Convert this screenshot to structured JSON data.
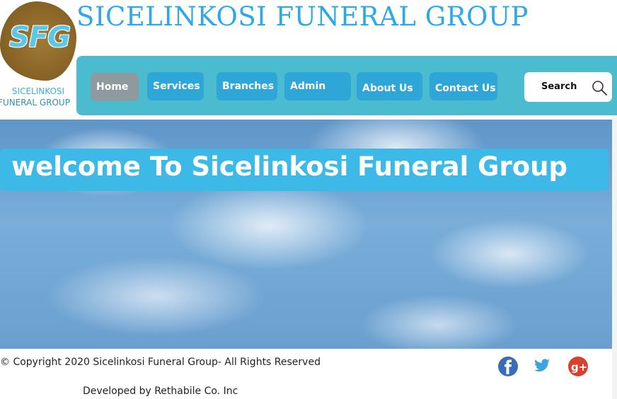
{
  "logo": {
    "initials": "SFG",
    "line1": "SICELINKOSI",
    "line2": "FUNERAL GROUP"
  },
  "site_title": "SICELINKOSI FUNERAL GROUP",
  "nav": {
    "items": [
      {
        "label": "Home",
        "active": true
      },
      {
        "label": "Services"
      },
      {
        "label": "Branches"
      },
      {
        "label": "Admin"
      },
      {
        "label": "About Us"
      },
      {
        "label": "Contact Us"
      }
    ],
    "search_label": "Search"
  },
  "hero": {
    "welcome": "welcome To Sicelinkosi Funeral Group"
  },
  "footer": {
    "copyright": "© Copyright 2020 Sicelinkosi Funeral Group- All Rights Reserved",
    "developer": "Developed by Rethabile Co. Inc"
  },
  "social": [
    {
      "name": "facebook-icon",
      "color": "#3b6cb7"
    },
    {
      "name": "twitter-icon",
      "color": "#3aa5e0"
    },
    {
      "name": "google-plus-icon",
      "color": "#d9412f"
    }
  ],
  "colors": {
    "title": "#2fa8e8",
    "navbar": "#4bbbcf",
    "nav_button": "#2ea6d8",
    "nav_active": "#8f9a9e",
    "banner": "#3cb9e6"
  }
}
